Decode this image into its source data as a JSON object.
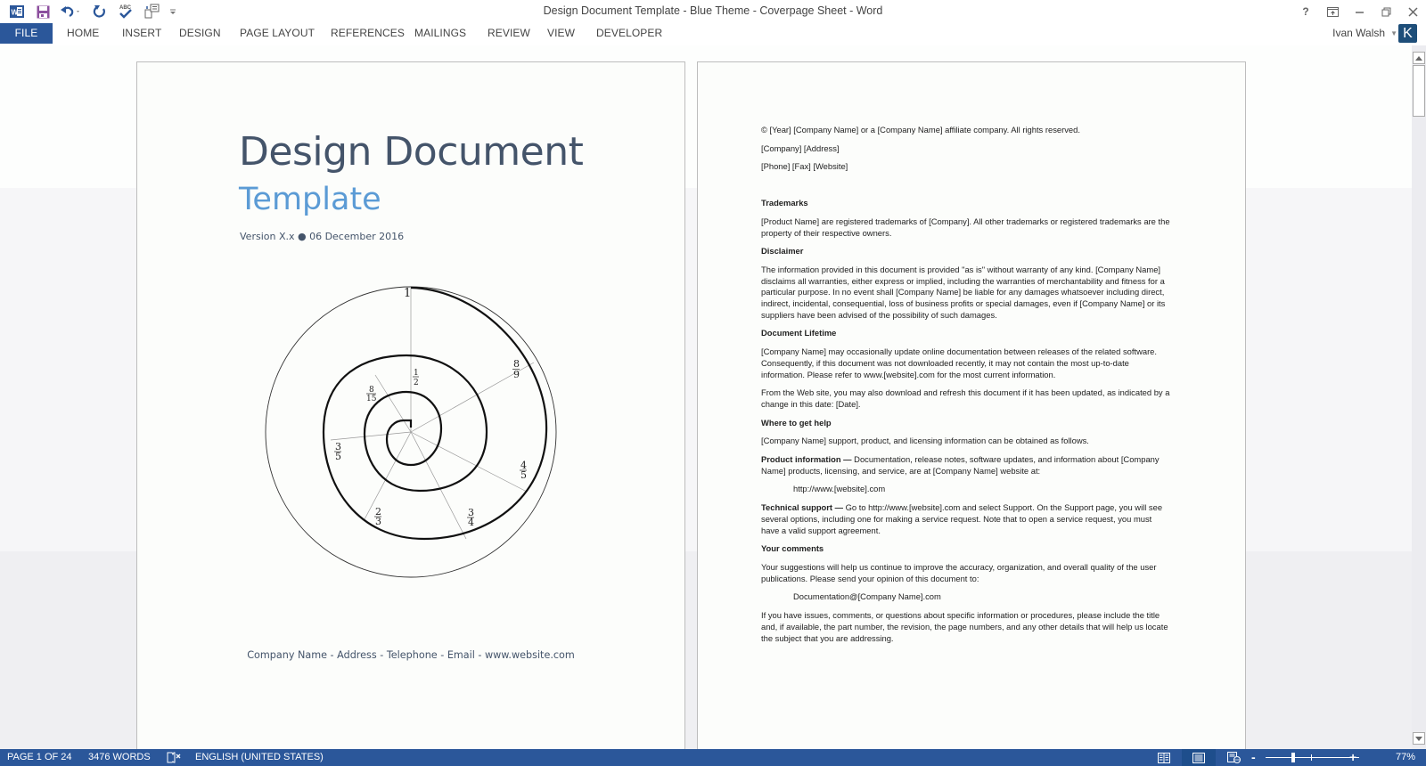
{
  "window": {
    "title": "Design Document Template - Blue Theme - Coverpage Sheet - Word",
    "controls": [
      "help",
      "ribbon-display-options",
      "minimize",
      "restore",
      "close"
    ]
  },
  "quick_access": {
    "items": [
      {
        "name": "word-app-icon"
      },
      {
        "name": "save-icon"
      },
      {
        "name": "undo-icon"
      },
      {
        "name": "redo-icon"
      },
      {
        "name": "spelling-check-icon"
      },
      {
        "name": "page-setup-icon"
      },
      {
        "name": "customize-qat-icon"
      }
    ]
  },
  "ribbon": {
    "tabs": [
      {
        "label": "FILE",
        "active": true
      },
      {
        "label": "HOME"
      },
      {
        "label": "INSERT"
      },
      {
        "label": "DESIGN"
      },
      {
        "label": "PAGE LAYOUT"
      },
      {
        "label": "REFERENCES"
      },
      {
        "label": "MAILINGS"
      },
      {
        "label": "REVIEW"
      },
      {
        "label": "VIEW"
      },
      {
        "label": "DEVELOPER"
      }
    ],
    "user_name": "Ivan Walsh",
    "avatar_letter": "K"
  },
  "cover": {
    "title": "Design Document",
    "subtitle": "Template",
    "version_line": "Version X.x ● 06 December 2016",
    "footer": "Company Name - Address - Telephone - Email - www.website.com",
    "spiral_labels": [
      "1",
      "8/9",
      "4/5",
      "3/4",
      "2/3",
      "3/5",
      "8/15",
      "1/2"
    ]
  },
  "page2": {
    "copyright": "© [Year] [Company Name] or a [Company Name] affiliate company. All rights reserved.",
    "address": "[Company] [Address]",
    "contact": "[Phone] [Fax] [Website]",
    "trademarks_heading": "Trademarks",
    "trademarks_text": "[Product Name] are registered trademarks of [Company]. All other trademarks or registered trademarks are the property of their respective owners.",
    "disclaimer_heading": "Disclaimer",
    "disclaimer_text": "The information provided in this document is provided \"as is\" without warranty of any kind. [Company Name] disclaims all warranties, either express or implied, including the warranties of merchantability and fitness for a particular purpose. In no event shall [Company Name] be liable for any damages whatsoever including direct, indirect, incidental, consequential, loss of business profits or special damages, even if [Company Name] or its suppliers have been advised of the possibility of such damages.",
    "lifetime_heading": "Document Lifetime",
    "lifetime_text1": "[Company Name] may occasionally update online documentation between releases of the related software. Consequently, if this document was not downloaded recently, it may not contain the most up-to-date information. Please refer to www.[website].com for the most current information.",
    "lifetime_text2": "From the Web site, you may also download and refresh this document if it has been updated, as indicated by a change in this date: [Date].",
    "help_heading": "Where to get help",
    "help_text": "[Company Name] support, product, and licensing information can be obtained as follows.",
    "product_info_label": "Product information —",
    "product_info_text": " Documentation, release notes, software updates, and information about [Company Name] products, licensing, and service, are at [Company Name] website at:",
    "product_url": "http://www.[website].com",
    "tech_support_label": "Technical support —",
    "tech_support_text": " Go to http://www.[website].com and select Support. On the Support page, you will see several options, including one for making a service request. Note that to open a service request, you must have a valid support agreement.",
    "comments_heading": "Your comments",
    "comments_text": "Your suggestions will help us continue to improve the accuracy, organization, and overall quality of the user publications. Please send your opinion of this document to:",
    "comments_email": "Documentation@[Company Name].com",
    "issues_text": "If you have issues, comments, or questions about specific information or procedures, please include the title and, if available, the part number, the revision, the page numbers, and any other details that will help us locate the subject that you are addressing."
  },
  "statusbar": {
    "page": "PAGE 1 OF 24",
    "words": "3476 WORDS",
    "language": "ENGLISH (UNITED STATES)",
    "view_modes": [
      "read-mode",
      "print-layout",
      "web-layout"
    ],
    "active_view": "print-layout",
    "zoom_minus": "-",
    "zoom_plus": "+",
    "zoom_level": "77%",
    "zoom_percent": 77
  },
  "colors": {
    "accent": "#2b579a",
    "title": "#44546a",
    "subtitle": "#5b9bd5",
    "avatar": "#1e4e79"
  }
}
